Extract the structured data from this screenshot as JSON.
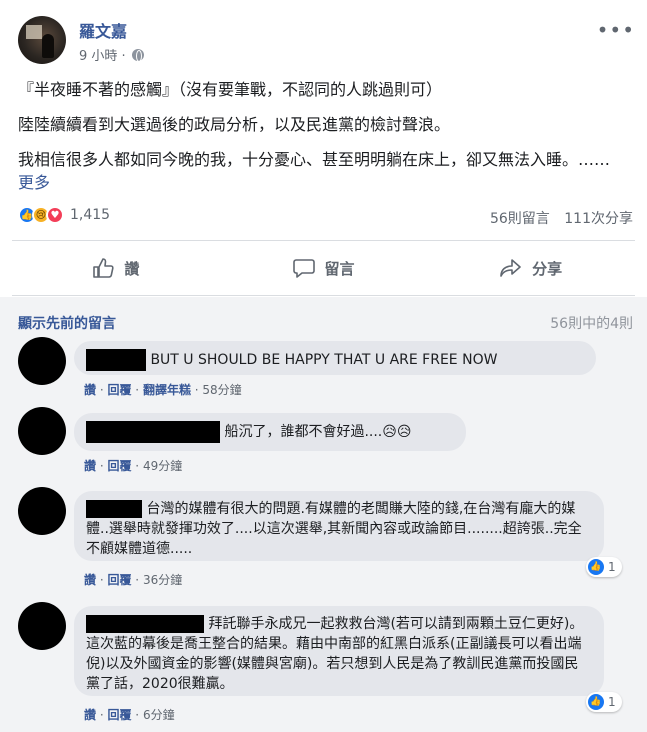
{
  "post": {
    "poster_name": "羅文嘉",
    "time": "9 小時 ·",
    "body": [
      "『半夜睡不著的感觸』（沒有要筆戰，不認同的人跳過則可）",
      "陸陸續續看到大選過後的政局分析，以及民進黨的檢討聲浪。",
      "我相信很多人都如同今晚的我，十分憂心、甚至明明躺在床上，卻又無法入睡。……"
    ],
    "see_more": "更多",
    "reaction_count": "1,415",
    "comment_count": "56則留言",
    "share_count": "111次分享"
  },
  "actions": {
    "like": "讚",
    "comment": "留言",
    "share": "分享"
  },
  "comments": {
    "view_previous": "顯示先前的留言",
    "count_label": "56則中的4則",
    "items": [
      {
        "text": "BUT U SHOULD BE HAPPY THAT U ARE FREE NOW",
        "like": "讚",
        "reply": "回覆",
        "translate": "翻譯年糕",
        "time": "58分鐘"
      },
      {
        "text": "船沉了，誰都不會好過....😥😥",
        "like": "讚",
        "reply": "回覆",
        "time": "49分鐘"
      },
      {
        "text": "台灣的媒體有很大的問題.有媒體的老闆賺大陸的錢,在台灣有龐大的媒體..選舉時就發揮功效了....以這次選舉,其新聞內容或政論節目........超誇張..完全不顧媒體道德.....",
        "like": "讚",
        "reply": "回覆",
        "time": "36分鐘",
        "reactions": "1"
      },
      {
        "text": "拜託聯手永成兄一起救救台灣(若可以請到兩顆土豆仁更好)。這次藍的幕後是喬王整合的結果。藉由中南部的紅黑白派系(正副議長可以看出端倪)以及外國資金的影響(媒體與宮廟)。若只想到人民是為了教訓民進黨而投國民黨了話，2020很難贏。",
        "like": "讚",
        "reply": "回覆",
        "time": "6分鐘",
        "reactions": "1"
      }
    ]
  }
}
